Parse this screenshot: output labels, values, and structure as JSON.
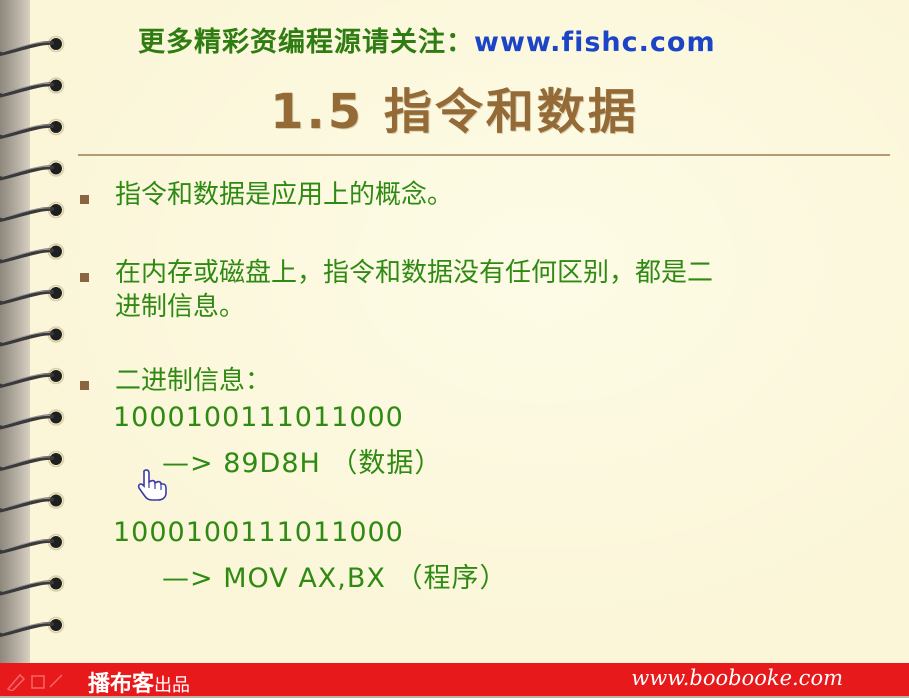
{
  "header": {
    "notice": "更多精彩资编程源请关注：",
    "url": "www.fishc.com"
  },
  "title": "1.5 指令和数据",
  "bullets": [
    {
      "lines": [
        "指令和数据是应用上的概念。"
      ]
    },
    {
      "lines": [
        "在内存或磁盘上，指令和数据没有任何区别，都是二",
        "进制信息。"
      ]
    },
    {
      "lines": [
        "二进制信息："
      ]
    }
  ],
  "examples": [
    {
      "binary": "1000100111011000",
      "arrow_text": "—> 89D8H （数据）"
    },
    {
      "binary": "1000100111011000",
      "arrow_text": "—> MOV AX,BX （程序）"
    }
  ],
  "footer": {
    "brand": "播布客",
    "brand_suffix": "出品",
    "url": "www.boobooke.com"
  },
  "colors": {
    "paper": "#fbf6d8",
    "text_green": "#2f8a14",
    "title_brown": "#946a37",
    "link_blue": "#1b45c6",
    "footer_red": "#e8191b"
  },
  "icons": {
    "cursor": "hand-pointer-icon",
    "binding": "spiral-binding-icon"
  }
}
